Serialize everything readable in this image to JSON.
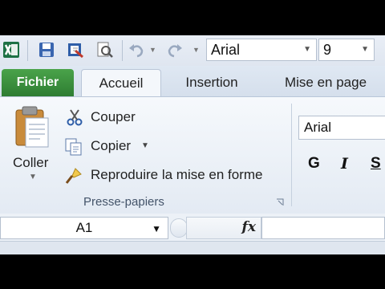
{
  "quick_access": {
    "font_name": "Arial",
    "font_size": "9",
    "icons": [
      "excel-logo-icon",
      "save-icon",
      "print-setup-icon",
      "print-preview-icon",
      "undo-icon",
      "redo-icon",
      "customize-qat-icon"
    ]
  },
  "tabs": {
    "file": "Fichier",
    "home": "Accueil",
    "insert": "Insertion",
    "page_layout": "Mise en page"
  },
  "clipboard": {
    "paste": "Coller",
    "cut": "Couper",
    "copy": "Copier",
    "format_painter": "Reproduire la mise en forme",
    "group_label": "Presse-papiers"
  },
  "font_group": {
    "font_name": "Arial",
    "bold": "G",
    "italic": "I",
    "underline": "S"
  },
  "formula_bar": {
    "name_box": "A1",
    "fx_label": "fx",
    "formula": ""
  },
  "colors": {
    "file_tab": "#2e7d32",
    "ribbon_bg": "#eef3f9",
    "excel_green": "#1e7145"
  }
}
